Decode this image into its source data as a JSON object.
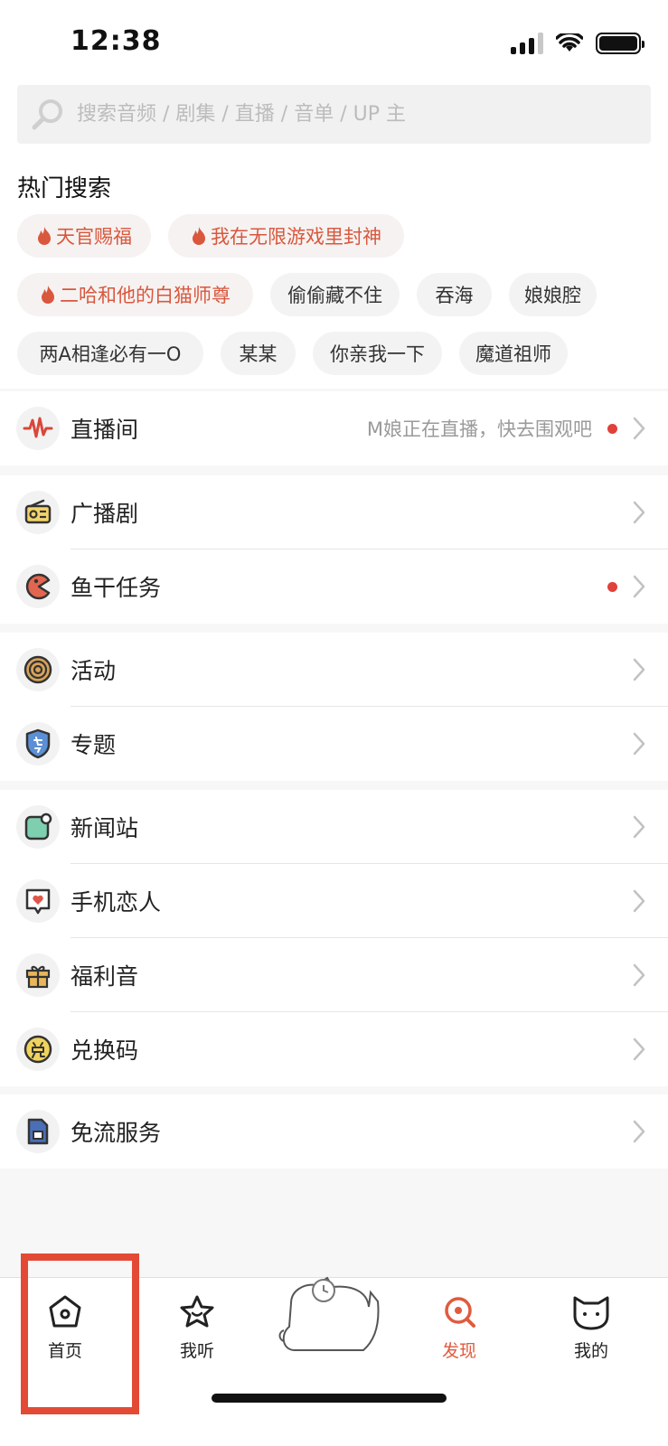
{
  "status_bar": {
    "time": "12:38"
  },
  "search": {
    "placeholder": "搜索音频 / 剧集 / 直播 / 音单 / UP 主"
  },
  "hot_search": {
    "title": "热门搜索",
    "tags": [
      {
        "label": "天官赐福",
        "hot": true
      },
      {
        "label": "我在无限游戏里封神",
        "hot": true
      },
      {
        "label": "二哈和他的白猫师尊",
        "hot": true
      },
      {
        "label": "偷偷藏不住",
        "hot": false
      },
      {
        "label": "吞海",
        "hot": false
      },
      {
        "label": "娘娘腔",
        "hot": false
      },
      {
        "label": "两A相逢必有一O",
        "hot": false
      },
      {
        "label": "某某",
        "hot": false
      },
      {
        "label": "你亲我一下",
        "hot": false
      },
      {
        "label": "魔道祖师",
        "hot": false
      }
    ]
  },
  "menu": {
    "live": {
      "label": "直播间",
      "hint": "M娘正在直播，快去围观吧"
    },
    "drama": {
      "label": "广播剧"
    },
    "fish_task": {
      "label": "鱼干任务"
    },
    "activity": {
      "label": "活动"
    },
    "topic": {
      "label": "专题"
    },
    "news": {
      "label": "新闻站"
    },
    "phone_lover": {
      "label": "手机恋人"
    },
    "welfare": {
      "label": "福利音"
    },
    "redeem": {
      "label": "兑换码"
    },
    "free_data": {
      "label": "免流服务"
    }
  },
  "tabbar": {
    "home": "首页",
    "listen": "我听",
    "discover": "发现",
    "mine": "我的"
  },
  "colors": {
    "accent": "#e05a3f",
    "highlight": "#e34a36",
    "dot": "#e0413a"
  }
}
